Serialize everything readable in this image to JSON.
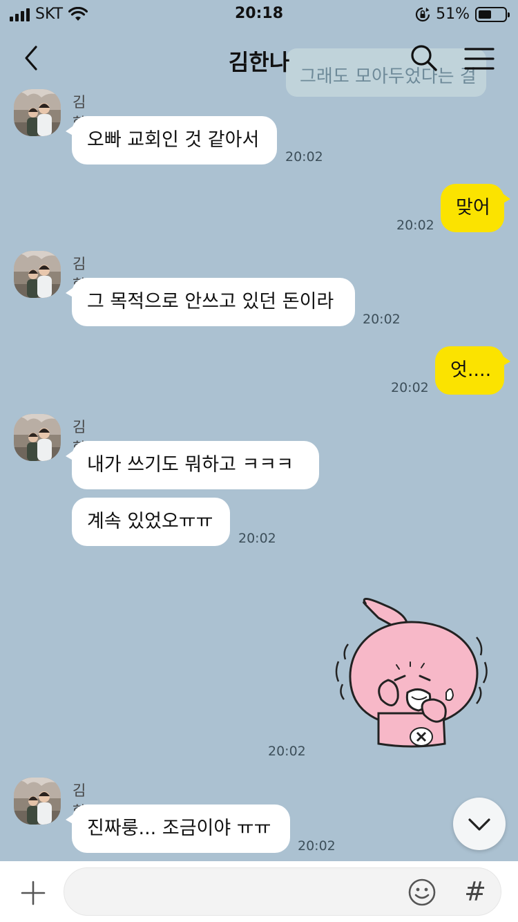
{
  "status_bar": {
    "carrier": "SKT",
    "time": "20:18",
    "battery_percent": "51%",
    "battery_level": 0.51
  },
  "header": {
    "title": "김한나",
    "overlay_preview": "그래도 모아두었다는 걸"
  },
  "messages": [
    {
      "sender": "김한나",
      "text": "오빠 교회인 것 같아서",
      "time": "20:02"
    },
    {
      "text": "맞어",
      "time": "20:02"
    },
    {
      "sender": "김한나",
      "text": "그 목적으로 안쓰고 있던 돈이라",
      "time": "20:02"
    },
    {
      "text": "엇....",
      "time": "20:02"
    },
    {
      "sender": "김한나",
      "text": "내가 쓰기도 뭐하고 ㅋㅋㅋ"
    },
    {
      "text": "계속 있었오ㅠㅠ",
      "time": "20:02"
    },
    {
      "sticker": "crying-pink-rabbit-sticker",
      "time": "20:02"
    },
    {
      "sender": "김한나",
      "text": "진짜룽... 조금이야 ㅠㅠ",
      "time": "20:02"
    }
  ],
  "colors": {
    "background": "#abc1d1",
    "incoming_bubble": "#ffffff",
    "outgoing_bubble": "#fbe300"
  }
}
